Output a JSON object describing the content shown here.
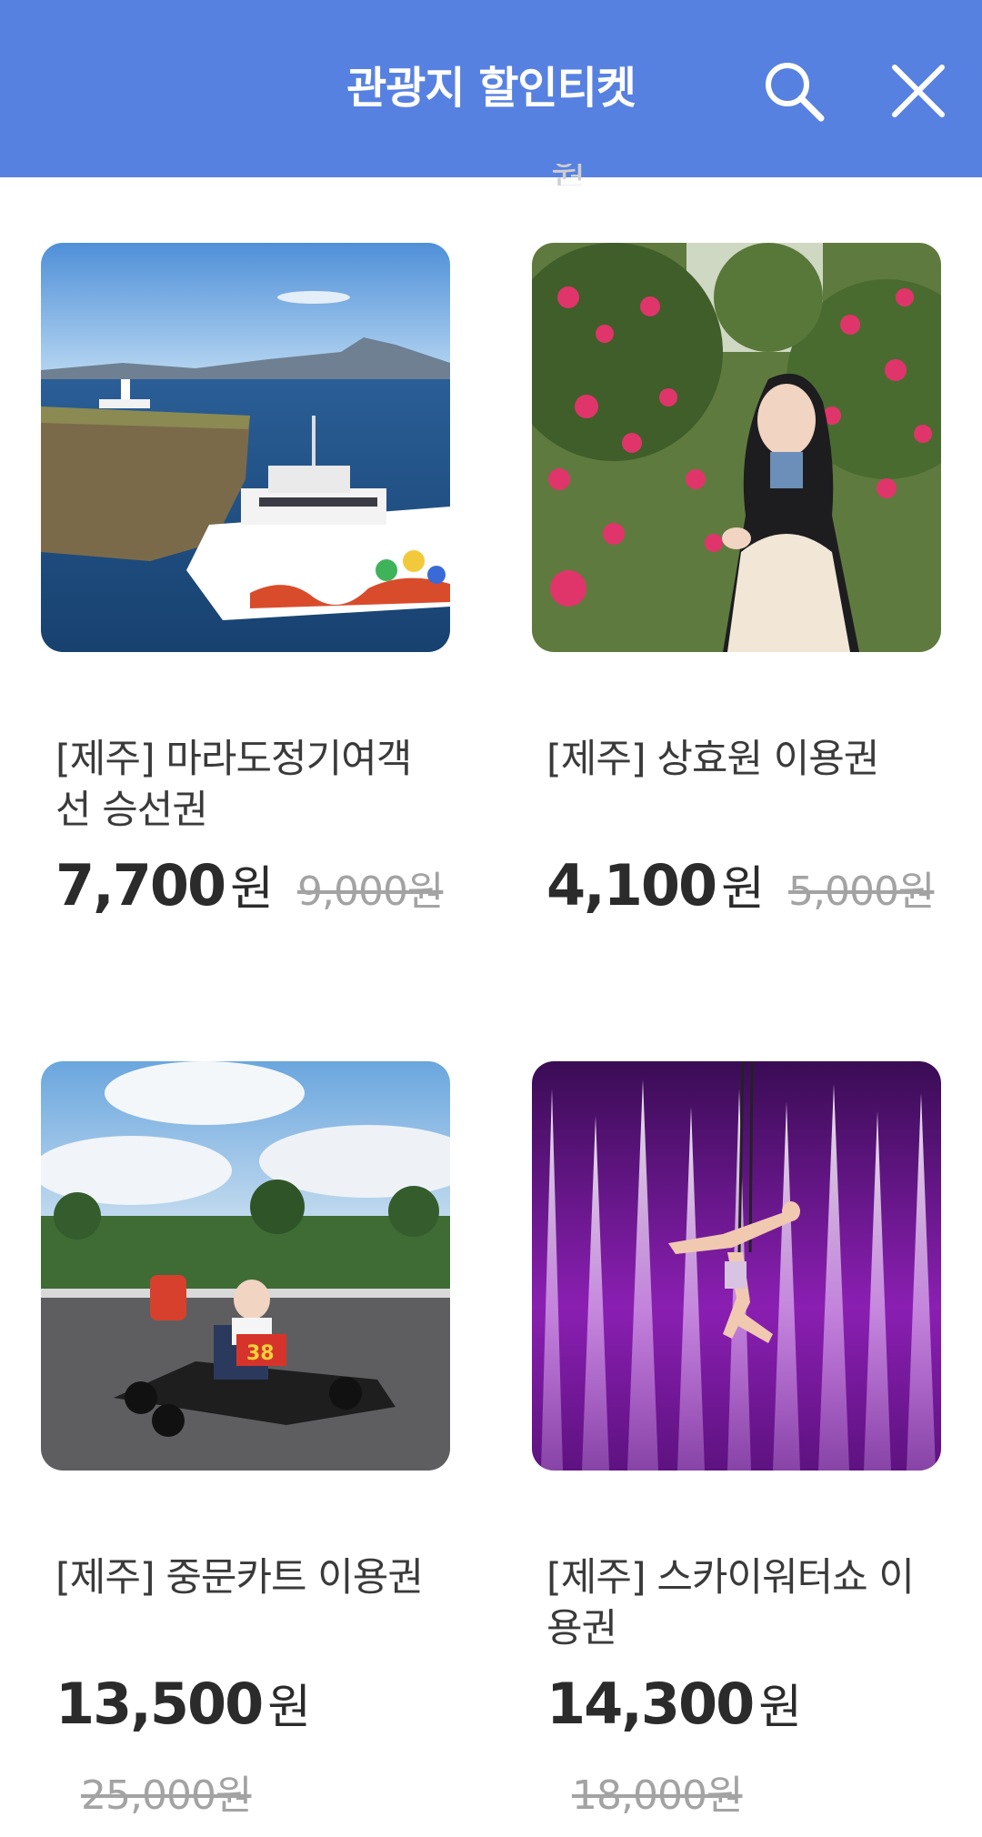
{
  "header": {
    "title": "관광지 할인티켓",
    "search_icon": "search-icon",
    "close_icon": "close-icon"
  },
  "cut_text": "원",
  "products": [
    {
      "title": "[제주] 마라도정기여객선 승선권",
      "price": "7,700",
      "currency": "원",
      "original_price": "9,000원",
      "image": "ferry-boat-photo"
    },
    {
      "title": "[제주] 상효원 이용권",
      "price": "4,100",
      "currency": "원",
      "original_price": "5,000원",
      "image": "camellia-garden-photo"
    },
    {
      "title": "[제주] 중문카트 이용권",
      "price": "13,500",
      "currency": "원",
      "original_price": "25,000원",
      "image": "go-kart-photo"
    },
    {
      "title": "[제주] 스카이워터쇼 이용권",
      "price": "14,300",
      "currency": "원",
      "original_price": "18,000원",
      "image": "sky-water-show-photo"
    }
  ],
  "colors": {
    "header_bg": "#5781e0",
    "text": "#2b2b2b",
    "strike_text": "#a3a3a3"
  }
}
